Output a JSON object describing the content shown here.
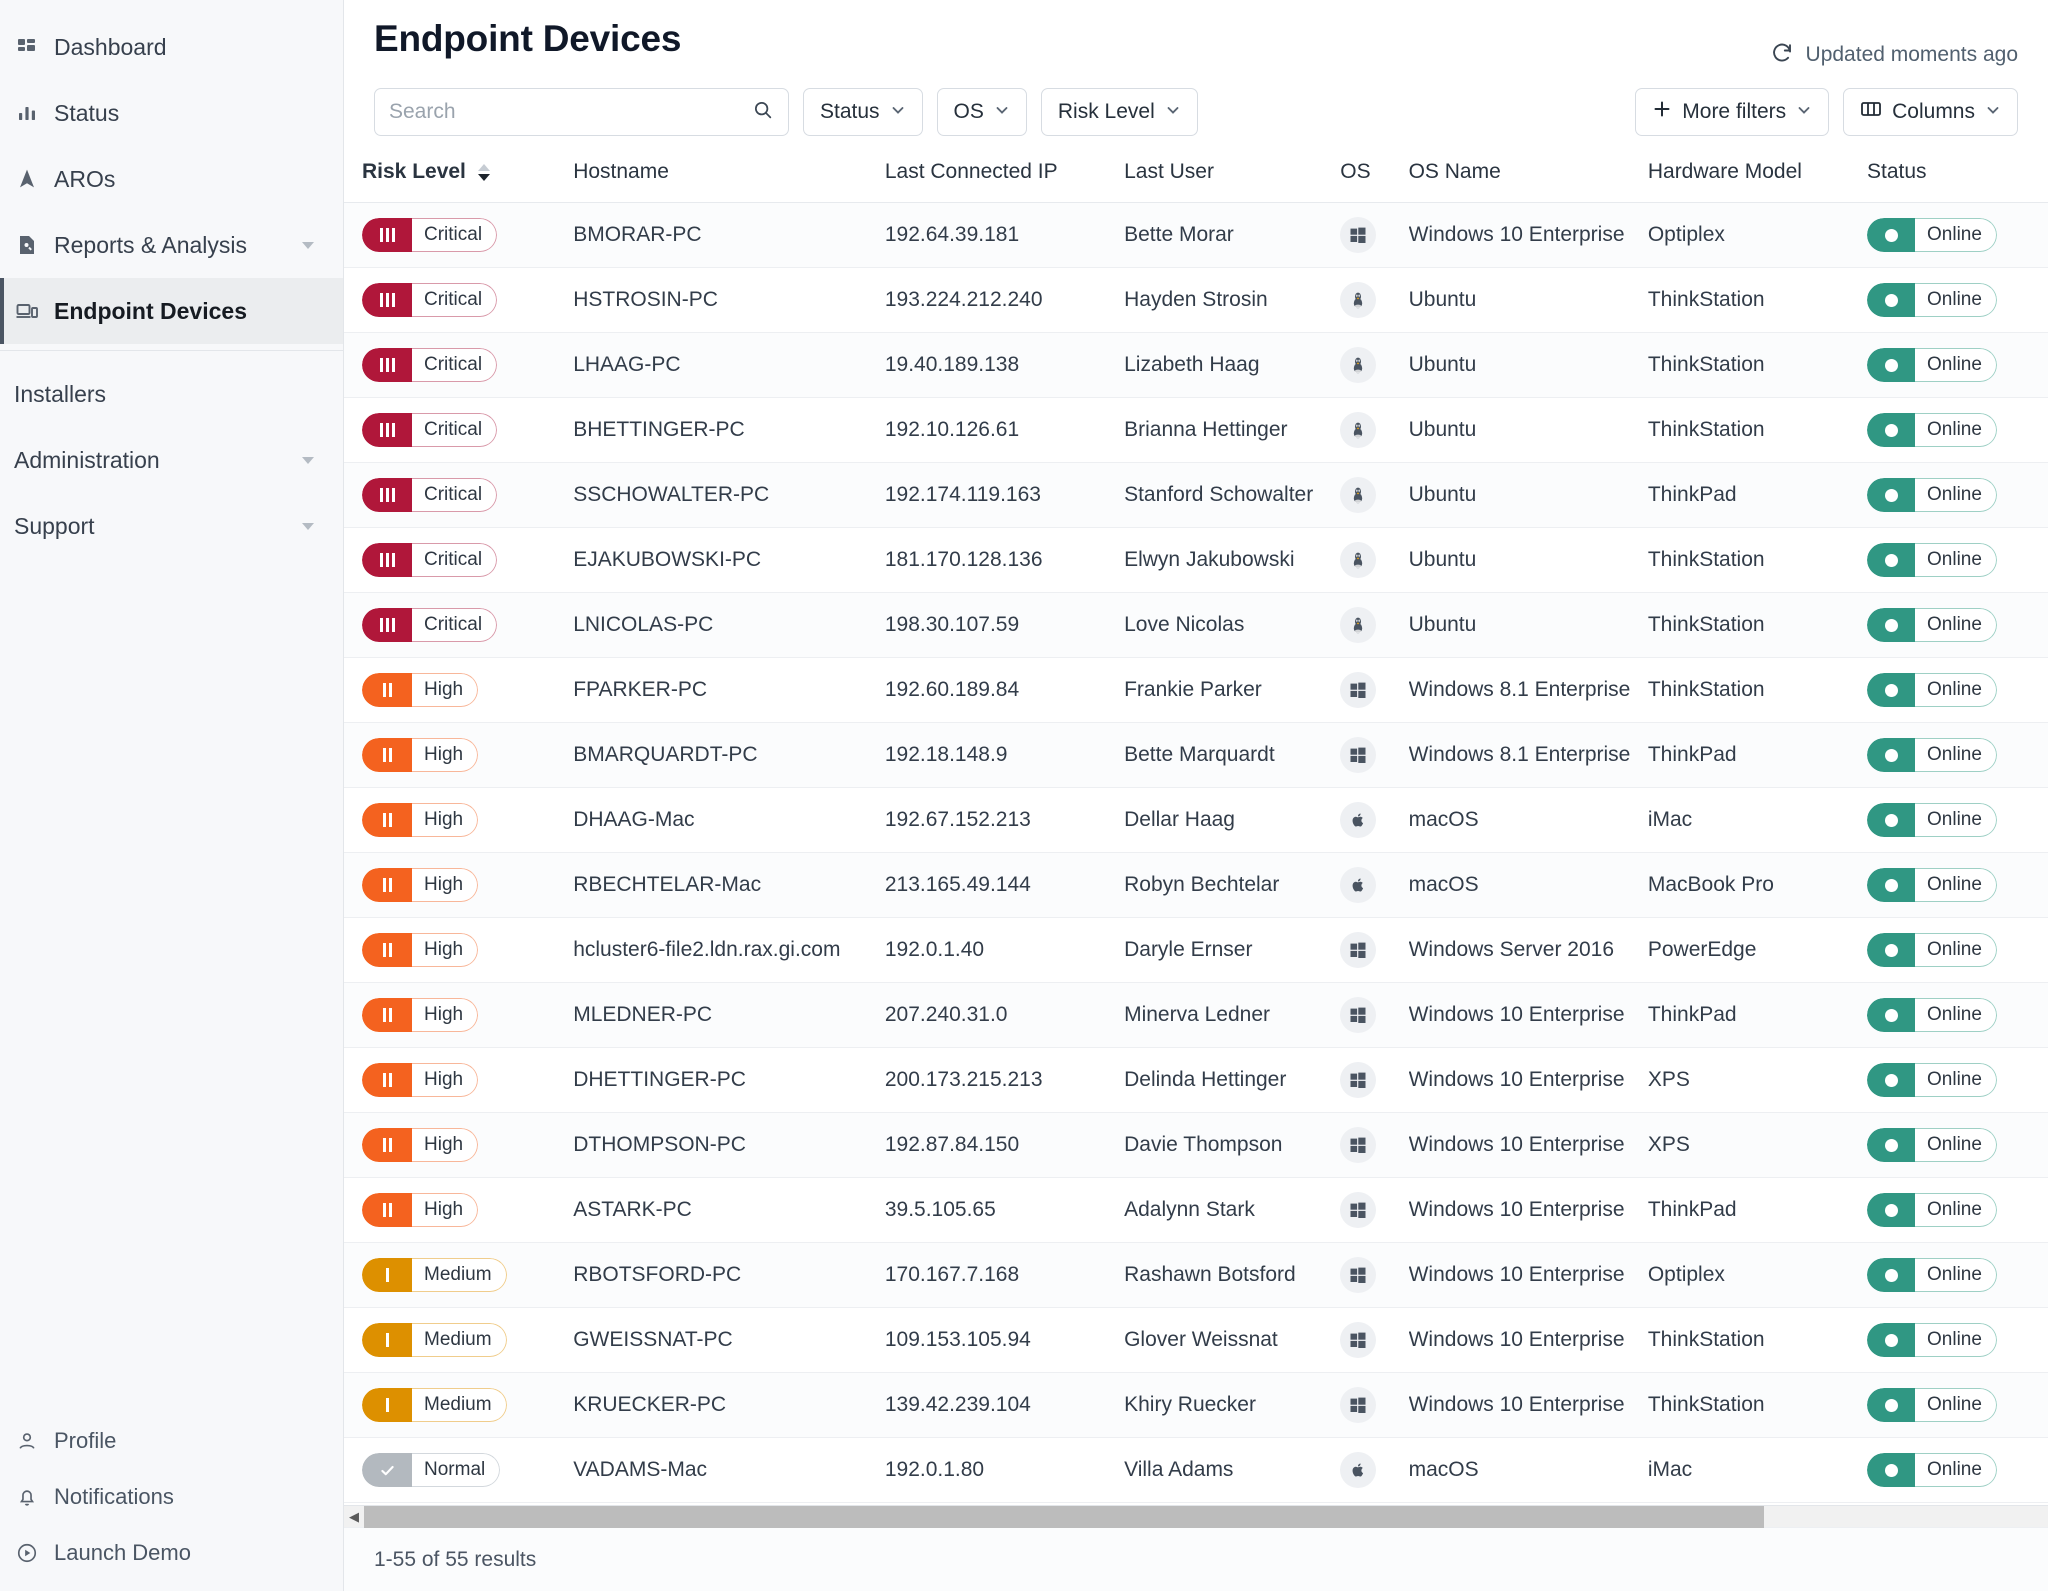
{
  "sidebar": {
    "items": [
      {
        "label": "Dashboard",
        "icon": "dashboard-icon",
        "active": false,
        "caret": false
      },
      {
        "label": "Status",
        "icon": "bar-chart-icon",
        "active": false,
        "caret": false
      },
      {
        "label": "AROs",
        "icon": "navigation-arrow-icon",
        "active": false,
        "caret": false
      },
      {
        "label": "Reports & Analysis",
        "icon": "report-search-icon",
        "active": false,
        "caret": true
      },
      {
        "label": "Endpoint Devices",
        "icon": "devices-icon",
        "active": true,
        "caret": false
      }
    ],
    "plain_items": [
      {
        "label": "Installers",
        "caret": false
      },
      {
        "label": "Administration",
        "caret": true
      },
      {
        "label": "Support",
        "caret": true
      }
    ],
    "bottom_items": [
      {
        "label": "Profile",
        "icon": "user-icon"
      },
      {
        "label": "Notifications",
        "icon": "bell-icon"
      },
      {
        "label": "Launch Demo",
        "icon": "play-circle-icon"
      }
    ]
  },
  "header": {
    "title": "Endpoint Devices",
    "updated_label": "Updated moments ago",
    "refresh_icon": "refresh-icon"
  },
  "toolbar": {
    "search_placeholder": "Search",
    "search_value": "",
    "search_icon": "search-icon",
    "filters": [
      {
        "label": "Status"
      },
      {
        "label": "OS"
      },
      {
        "label": "Risk Level"
      }
    ],
    "more_filters_label": "More filters",
    "more_filters_icon": "plus-icon",
    "columns_label": "Columns",
    "columns_icon": "columns-icon"
  },
  "table": {
    "columns": [
      {
        "key": "risk",
        "label": "Risk Level",
        "sorted": true,
        "sort_dir": "desc"
      },
      {
        "key": "host",
        "label": "Hostname",
        "sorted": false
      },
      {
        "key": "ip",
        "label": "Last Connected IP",
        "sorted": false
      },
      {
        "key": "user",
        "label": "Last User",
        "sorted": false
      },
      {
        "key": "os",
        "label": "OS",
        "sorted": false
      },
      {
        "key": "osname",
        "label": "OS Name",
        "sorted": false
      },
      {
        "key": "hw",
        "label": "Hardware Model",
        "sorted": false
      },
      {
        "key": "status",
        "label": "Status",
        "sorted": false
      }
    ],
    "rows": [
      {
        "risk": "Critical",
        "risk_level": "critical",
        "host": "BMORAR-PC",
        "ip": "192.64.39.181",
        "user": "Bette Morar",
        "os": "windows",
        "osname": "Windows 10 Enterprise",
        "hw": "Optiplex",
        "status": "Online"
      },
      {
        "risk": "Critical",
        "risk_level": "critical",
        "host": "HSTROSIN-PC",
        "ip": "193.224.212.240",
        "user": "Hayden Strosin",
        "os": "linux",
        "osname": "Ubuntu",
        "hw": "ThinkStation",
        "status": "Online"
      },
      {
        "risk": "Critical",
        "risk_level": "critical",
        "host": "LHAAG-PC",
        "ip": "19.40.189.138",
        "user": "Lizabeth Haag",
        "os": "linux",
        "osname": "Ubuntu",
        "hw": "ThinkStation",
        "status": "Online"
      },
      {
        "risk": "Critical",
        "risk_level": "critical",
        "host": "BHETTINGER-PC",
        "ip": "192.10.126.61",
        "user": "Brianna Hettinger",
        "os": "linux",
        "osname": "Ubuntu",
        "hw": "ThinkStation",
        "status": "Online"
      },
      {
        "risk": "Critical",
        "risk_level": "critical",
        "host": "SSCHOWALTER-PC",
        "ip": "192.174.119.163",
        "user": "Stanford Schowalter",
        "os": "linux",
        "osname": "Ubuntu",
        "hw": "ThinkPad",
        "status": "Online"
      },
      {
        "risk": "Critical",
        "risk_level": "critical",
        "host": "EJAKUBOWSKI-PC",
        "ip": "181.170.128.136",
        "user": "Elwyn Jakubowski",
        "os": "linux",
        "osname": "Ubuntu",
        "hw": "ThinkStation",
        "status": "Online"
      },
      {
        "risk": "Critical",
        "risk_level": "critical",
        "host": "LNICOLAS-PC",
        "ip": "198.30.107.59",
        "user": "Love Nicolas",
        "os": "linux",
        "osname": "Ubuntu",
        "hw": "ThinkStation",
        "status": "Online"
      },
      {
        "risk": "High",
        "risk_level": "high",
        "host": "FPARKER-PC",
        "ip": "192.60.189.84",
        "user": "Frankie Parker",
        "os": "windows",
        "osname": "Windows 8.1 Enterprise",
        "hw": "ThinkStation",
        "status": "Online"
      },
      {
        "risk": "High",
        "risk_level": "high",
        "host": "BMARQUARDT-PC",
        "ip": "192.18.148.9",
        "user": "Bette Marquardt",
        "os": "windows",
        "osname": "Windows 8.1 Enterprise",
        "hw": "ThinkPad",
        "status": "Online"
      },
      {
        "risk": "High",
        "risk_level": "high",
        "host": "DHAAG-Mac",
        "ip": "192.67.152.213",
        "user": "Dellar Haag",
        "os": "apple",
        "osname": "macOS",
        "hw": "iMac",
        "status": "Online"
      },
      {
        "risk": "High",
        "risk_level": "high",
        "host": "RBECHTELAR-Mac",
        "ip": "213.165.49.144",
        "user": "Robyn Bechtelar",
        "os": "apple",
        "osname": "macOS",
        "hw": "MacBook Pro",
        "status": "Online"
      },
      {
        "risk": "High",
        "risk_level": "high",
        "host": "hcluster6-file2.ldn.rax.gi.com",
        "ip": "192.0.1.40",
        "user": "Daryle Ernser",
        "os": "windows",
        "osname": "Windows Server 2016",
        "hw": "PowerEdge",
        "status": "Online"
      },
      {
        "risk": "High",
        "risk_level": "high",
        "host": "MLEDNER-PC",
        "ip": "207.240.31.0",
        "user": "Minerva Ledner",
        "os": "windows",
        "osname": "Windows 10 Enterprise",
        "hw": "ThinkPad",
        "status": "Online"
      },
      {
        "risk": "High",
        "risk_level": "high",
        "host": "DHETTINGER-PC",
        "ip": "200.173.215.213",
        "user": "Delinda Hettinger",
        "os": "windows",
        "osname": "Windows 10 Enterprise",
        "hw": "XPS",
        "status": "Online"
      },
      {
        "risk": "High",
        "risk_level": "high",
        "host": "DTHOMPSON-PC",
        "ip": "192.87.84.150",
        "user": "Davie Thompson",
        "os": "windows",
        "osname": "Windows 10 Enterprise",
        "hw": "XPS",
        "status": "Online"
      },
      {
        "risk": "High",
        "risk_level": "high",
        "host": "ASTARK-PC",
        "ip": "39.5.105.65",
        "user": "Adalynn Stark",
        "os": "windows",
        "osname": "Windows 10 Enterprise",
        "hw": "ThinkPad",
        "status": "Online"
      },
      {
        "risk": "Medium",
        "risk_level": "medium",
        "host": "RBOTSFORD-PC",
        "ip": "170.167.7.168",
        "user": "Rashawn Botsford",
        "os": "windows",
        "osname": "Windows 10 Enterprise",
        "hw": "Optiplex",
        "status": "Online"
      },
      {
        "risk": "Medium",
        "risk_level": "medium",
        "host": "GWEISSNAT-PC",
        "ip": "109.153.105.94",
        "user": "Glover Weissnat",
        "os": "windows",
        "osname": "Windows 10 Enterprise",
        "hw": "ThinkStation",
        "status": "Online"
      },
      {
        "risk": "Medium",
        "risk_level": "medium",
        "host": "KRUECKER-PC",
        "ip": "139.42.239.104",
        "user": "Khiry Ruecker",
        "os": "windows",
        "osname": "Windows 10 Enterprise",
        "hw": "ThinkStation",
        "status": "Online"
      },
      {
        "risk": "Normal",
        "risk_level": "normal",
        "host": "VADAMS-Mac",
        "ip": "192.0.1.80",
        "user": "Villa Adams",
        "os": "apple",
        "osname": "macOS",
        "hw": "iMac",
        "status": "Online"
      }
    ]
  },
  "footer": {
    "results_label": "1-55 of 55 results"
  },
  "colors": {
    "critical": "#b0173a",
    "high": "#f4621f",
    "medium": "#dd9000",
    "normal": "#b3b9bf",
    "online": "#309783",
    "sidebar_bg": "#f7f8fa",
    "active_bg": "#ebedef"
  }
}
